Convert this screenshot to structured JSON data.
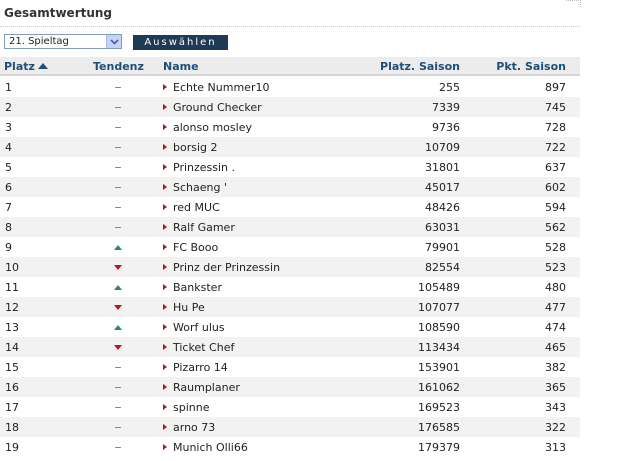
{
  "title": "Gesamtwertung",
  "selector": {
    "value": "21. Spieltag"
  },
  "button_label": "Auswählen",
  "columns": {
    "platz": "Platz",
    "tendenz": "Tendenz",
    "name": "Name",
    "platz_saison": "Platz. Saison",
    "pkt_saison": "Pkt. Saison"
  },
  "colors": {
    "header_text": "#1f4e79",
    "button_bg": "#1f3a57",
    "up": "#2e8b57",
    "down": "#c0141b",
    "bullet": "#b01818"
  },
  "rows": [
    {
      "platz": "1",
      "tendenz": "same",
      "name": "Echte Nummer10",
      "platz_saison": "255",
      "pkt_saison": "897"
    },
    {
      "platz": "2",
      "tendenz": "same",
      "name": "Ground Checker",
      "platz_saison": "7339",
      "pkt_saison": "745"
    },
    {
      "platz": "3",
      "tendenz": "same",
      "name": "alonso mosley",
      "platz_saison": "9736",
      "pkt_saison": "728"
    },
    {
      "platz": "4",
      "tendenz": "same",
      "name": "borsig 2",
      "platz_saison": "10709",
      "pkt_saison": "722"
    },
    {
      "platz": "5",
      "tendenz": "same",
      "name": "Prinzessin .",
      "platz_saison": "31801",
      "pkt_saison": "637"
    },
    {
      "platz": "6",
      "tendenz": "same",
      "name": "Schaeng '",
      "platz_saison": "45017",
      "pkt_saison": "602"
    },
    {
      "platz": "7",
      "tendenz": "same",
      "name": "red MUC",
      "platz_saison": "48426",
      "pkt_saison": "594"
    },
    {
      "platz": "8",
      "tendenz": "same",
      "name": "Ralf Gamer",
      "platz_saison": "63031",
      "pkt_saison": "562"
    },
    {
      "platz": "9",
      "tendenz": "up",
      "name": "FC Booo",
      "platz_saison": "79901",
      "pkt_saison": "528"
    },
    {
      "platz": "10",
      "tendenz": "down",
      "name": "Prinz der Prinzessin",
      "platz_saison": "82554",
      "pkt_saison": "523"
    },
    {
      "platz": "11",
      "tendenz": "up",
      "name": "Bankster",
      "platz_saison": "105489",
      "pkt_saison": "480"
    },
    {
      "platz": "12",
      "tendenz": "down",
      "name": "Hu Pe",
      "platz_saison": "107077",
      "pkt_saison": "477"
    },
    {
      "platz": "13",
      "tendenz": "up",
      "name": "Worf ulus",
      "platz_saison": "108590",
      "pkt_saison": "474"
    },
    {
      "platz": "14",
      "tendenz": "down",
      "name": "Ticket Chef",
      "platz_saison": "113434",
      "pkt_saison": "465"
    },
    {
      "platz": "15",
      "tendenz": "same",
      "name": "Pizarro 14",
      "platz_saison": "153901",
      "pkt_saison": "382"
    },
    {
      "platz": "16",
      "tendenz": "same",
      "name": "Raumplaner",
      "platz_saison": "161062",
      "pkt_saison": "365"
    },
    {
      "platz": "17",
      "tendenz": "same",
      "name": "spinne",
      "platz_saison": "169523",
      "pkt_saison": "343"
    },
    {
      "platz": "18",
      "tendenz": "same",
      "name": "arno 73",
      "platz_saison": "176585",
      "pkt_saison": "322"
    },
    {
      "platz": "19",
      "tendenz": "same",
      "name": "Munich Olli66",
      "platz_saison": "179379",
      "pkt_saison": "313"
    }
  ]
}
